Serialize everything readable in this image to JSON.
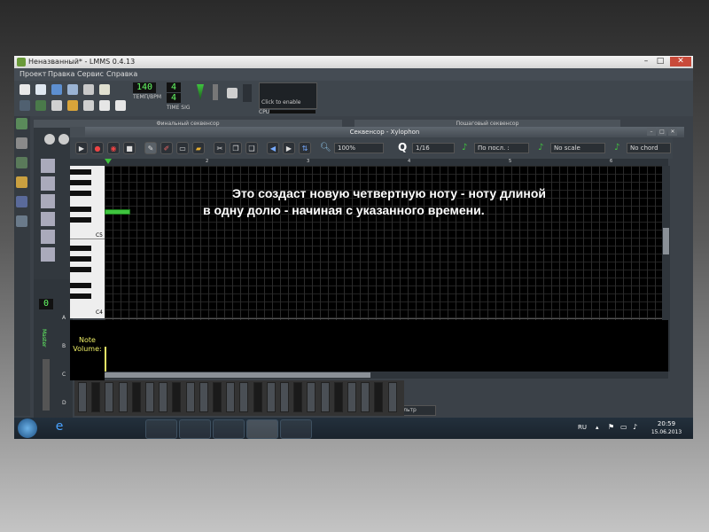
{
  "window": {
    "title": "Неназванный* - LMMS 0.4.13",
    "minimize": "–",
    "maximize": "□",
    "close": "✕"
  },
  "menu": [
    "Проект",
    "Правка",
    "Сервис",
    "Справка"
  ],
  "toolbar": {
    "tempo_value": "140",
    "tempo_label": "ТЕМП/BPM",
    "timesig_top": "4",
    "timesig_bottom": "4",
    "timesig_label": "TIME SIG",
    "cpu_label": "CPU",
    "click_to_enable": "Click to enable"
  },
  "song_editor": {
    "title": "Финальный секвенсор"
  },
  "beat_editor": {
    "title": "Пошаговый секвенсор"
  },
  "fx_mixer": {
    "master_label": "Master",
    "add_filter": "Добавить фильтр",
    "channel_letters": [
      "A",
      "B",
      "C",
      "D"
    ]
  },
  "piano_roll": {
    "title": "Секвенсор - Xylophon",
    "zoom": "100%",
    "quantize": "1/16",
    "note_length": "По посл. :",
    "scale": "No scale",
    "chord": "No chord",
    "key_c5": "C5",
    "key_c4": "C4",
    "note_volume_label": "Note Volume:",
    "ruler": [
      "1",
      "2",
      "3",
      "4",
      "5",
      "6"
    ]
  },
  "taskbar": {
    "lang": "RU",
    "time": "20:59",
    "date": "15.06.2013"
  },
  "caption": {
    "line1": "Это создаст новую четвертную ноту - ноту длиной",
    "line2": "в одну долю - начиная с указанного времени."
  },
  "colors": {
    "accent_green": "#3fc43f",
    "grid_bg": "#000000",
    "window_bg": "#3b4148"
  }
}
